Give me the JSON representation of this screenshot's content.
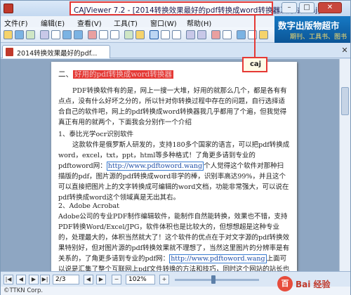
{
  "window": {
    "title": "CAJViewer 7.2 - [2014转换效果最好的pdf转换成word转换器及方法 .caj]",
    "controls": {
      "minimize": "–",
      "maximize": "□",
      "close": "✕"
    }
  },
  "menu": [
    "文件(F)",
    "编辑(E)",
    "查看(V)",
    "工具(T)",
    "窗口(W)",
    "帮助(H)"
  ],
  "ad": {
    "title": "数字出版物超市",
    "subtitle": "期刊、工具书、图书"
  },
  "tab": {
    "label": "2014转换效果最好的pdf...",
    "close": "✕"
  },
  "callout": {
    "text": "caj"
  },
  "document": {
    "heading_prefix": "二、",
    "heading_highlight": "好用的pdf转换成word转换器",
    "p1": "PDF转换软件有的是，网上一搜一大堆，好用的就那么几个，都是各有有点点，没有什么好坏之分的，所以针对你转换过程中存在的问题，自行选择适合自己的软件吧，网上的pdf转换成word转换器我几乎都用了个遍，但我觉得真正有用的就两个，下面我会分别作一个介绍",
    "item1_title": "1、泰比光学ocr识别软件",
    "p2_a": "这款软件是俄罗斯人研发的，支持180多个国家的语言，可以把pdf转换成word，excel，txt，ppt，html等多种格式！了角更多请到专业的pdftoword网：",
    "link1": "http://www.pdftoword.wang",
    "p2_b": "个人觉得这个软件对那种扫描版的pdf，图片源的pdf转换成word非学的棒，识别率高达99%，并且这个可以直接把图片上的文字转换成可编辑的word文档，功能非常强大，可以说在pdf转换成word这个领域真是无出其右。",
    "item2_title": "2、Adobe Acrobat",
    "p3_a": "Adobe公司的专业PDF制作编辑软件，能制作自然能转换，效果也不错，支持PDF转换Word/Excel/JPG，软件体积也是比较大的，但想想超是这种专业的，处理最大的，体积当然就大了！这个软件的优点在于对文字源的pdf转换效果特别好，但对图片源的pdf转换效果就不理想了，当然这里图片的分辨率是有关系的，了角更多请到专业的pdf网：",
    "link2": "http://www.pdftoword.wang",
    "p3_b": "上面可以说是汇集了整个互联网上pdf文件转换的方法和技巧，同时这个网站的站长也提供上面两款软件的破解版，免得你在网上找一半天也找不到合适的！"
  },
  "statusbar": {
    "page": "2/3",
    "zoom": "102%"
  },
  "footer": {
    "copyright": "©TTKN Corp."
  },
  "watermark": {
    "badge": "百",
    "text": "Bai 经验"
  }
}
